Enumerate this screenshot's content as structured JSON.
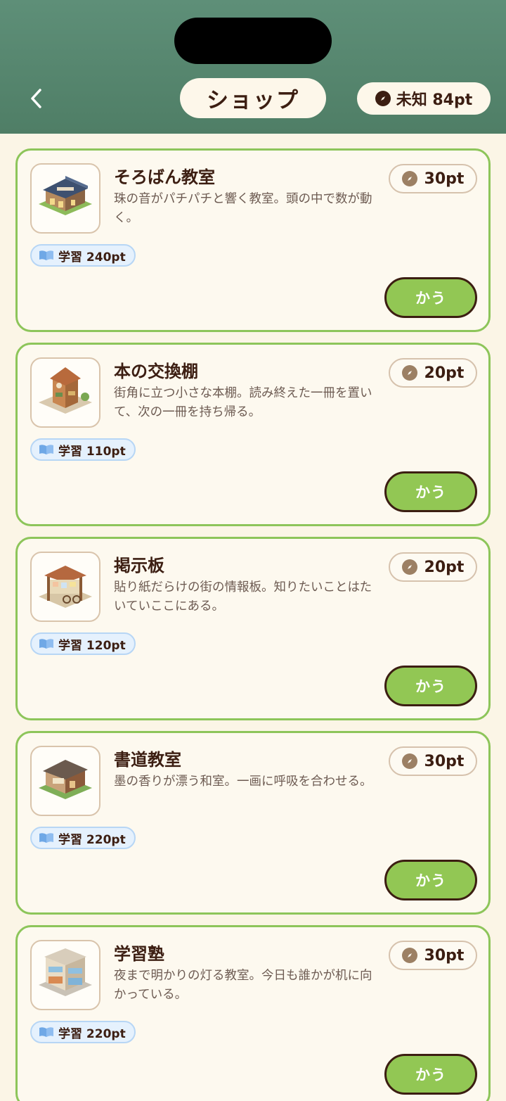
{
  "header": {
    "title": "ショップ",
    "points_label": "未知 84pt",
    "back_icon": "chevron-left-icon"
  },
  "colors": {
    "header_bg": "#5e8f78",
    "page_bg": "#fbf5e6",
    "card_border": "#8dc55a",
    "buy_button": "#92c754",
    "text_dark": "#3c1e12",
    "study_tag_bg": "#e5f1fd"
  },
  "items": [
    {
      "name": "そろばん教室",
      "description": "珠の音がパチパチと響く教室。頭の中で数が動く。",
      "price": "30pt",
      "study_tag": "学習 240pt",
      "buy_label": "かう",
      "image": "traditional-school-building"
    },
    {
      "name": "本の交換棚",
      "description": "街角に立つ小さな本棚。読み終えた一冊を置いて、次の一冊を持ち帰る。",
      "price": "20pt",
      "study_tag": "学習 110pt",
      "buy_label": "かう",
      "image": "wooden-book-kiosk"
    },
    {
      "name": "掲示板",
      "description": "貼り紙だらけの街の情報板。知りたいことはたいていここにある。",
      "price": "20pt",
      "study_tag": "学習 120pt",
      "buy_label": "かう",
      "image": "bulletin-board-with-bicycle"
    },
    {
      "name": "書道教室",
      "description": "墨の香りが漂う和室。一画に呼吸を合わせる。",
      "price": "30pt",
      "study_tag": "学習 220pt",
      "buy_label": "かう",
      "image": "calligraphy-school-house"
    },
    {
      "name": "学習塾",
      "description": "夜まで明かりの灯る教室。今日も誰かが机に向かっている。",
      "price": "30pt",
      "study_tag": "学習 220pt",
      "buy_label": "かう",
      "image": "cram-school-building"
    }
  ]
}
